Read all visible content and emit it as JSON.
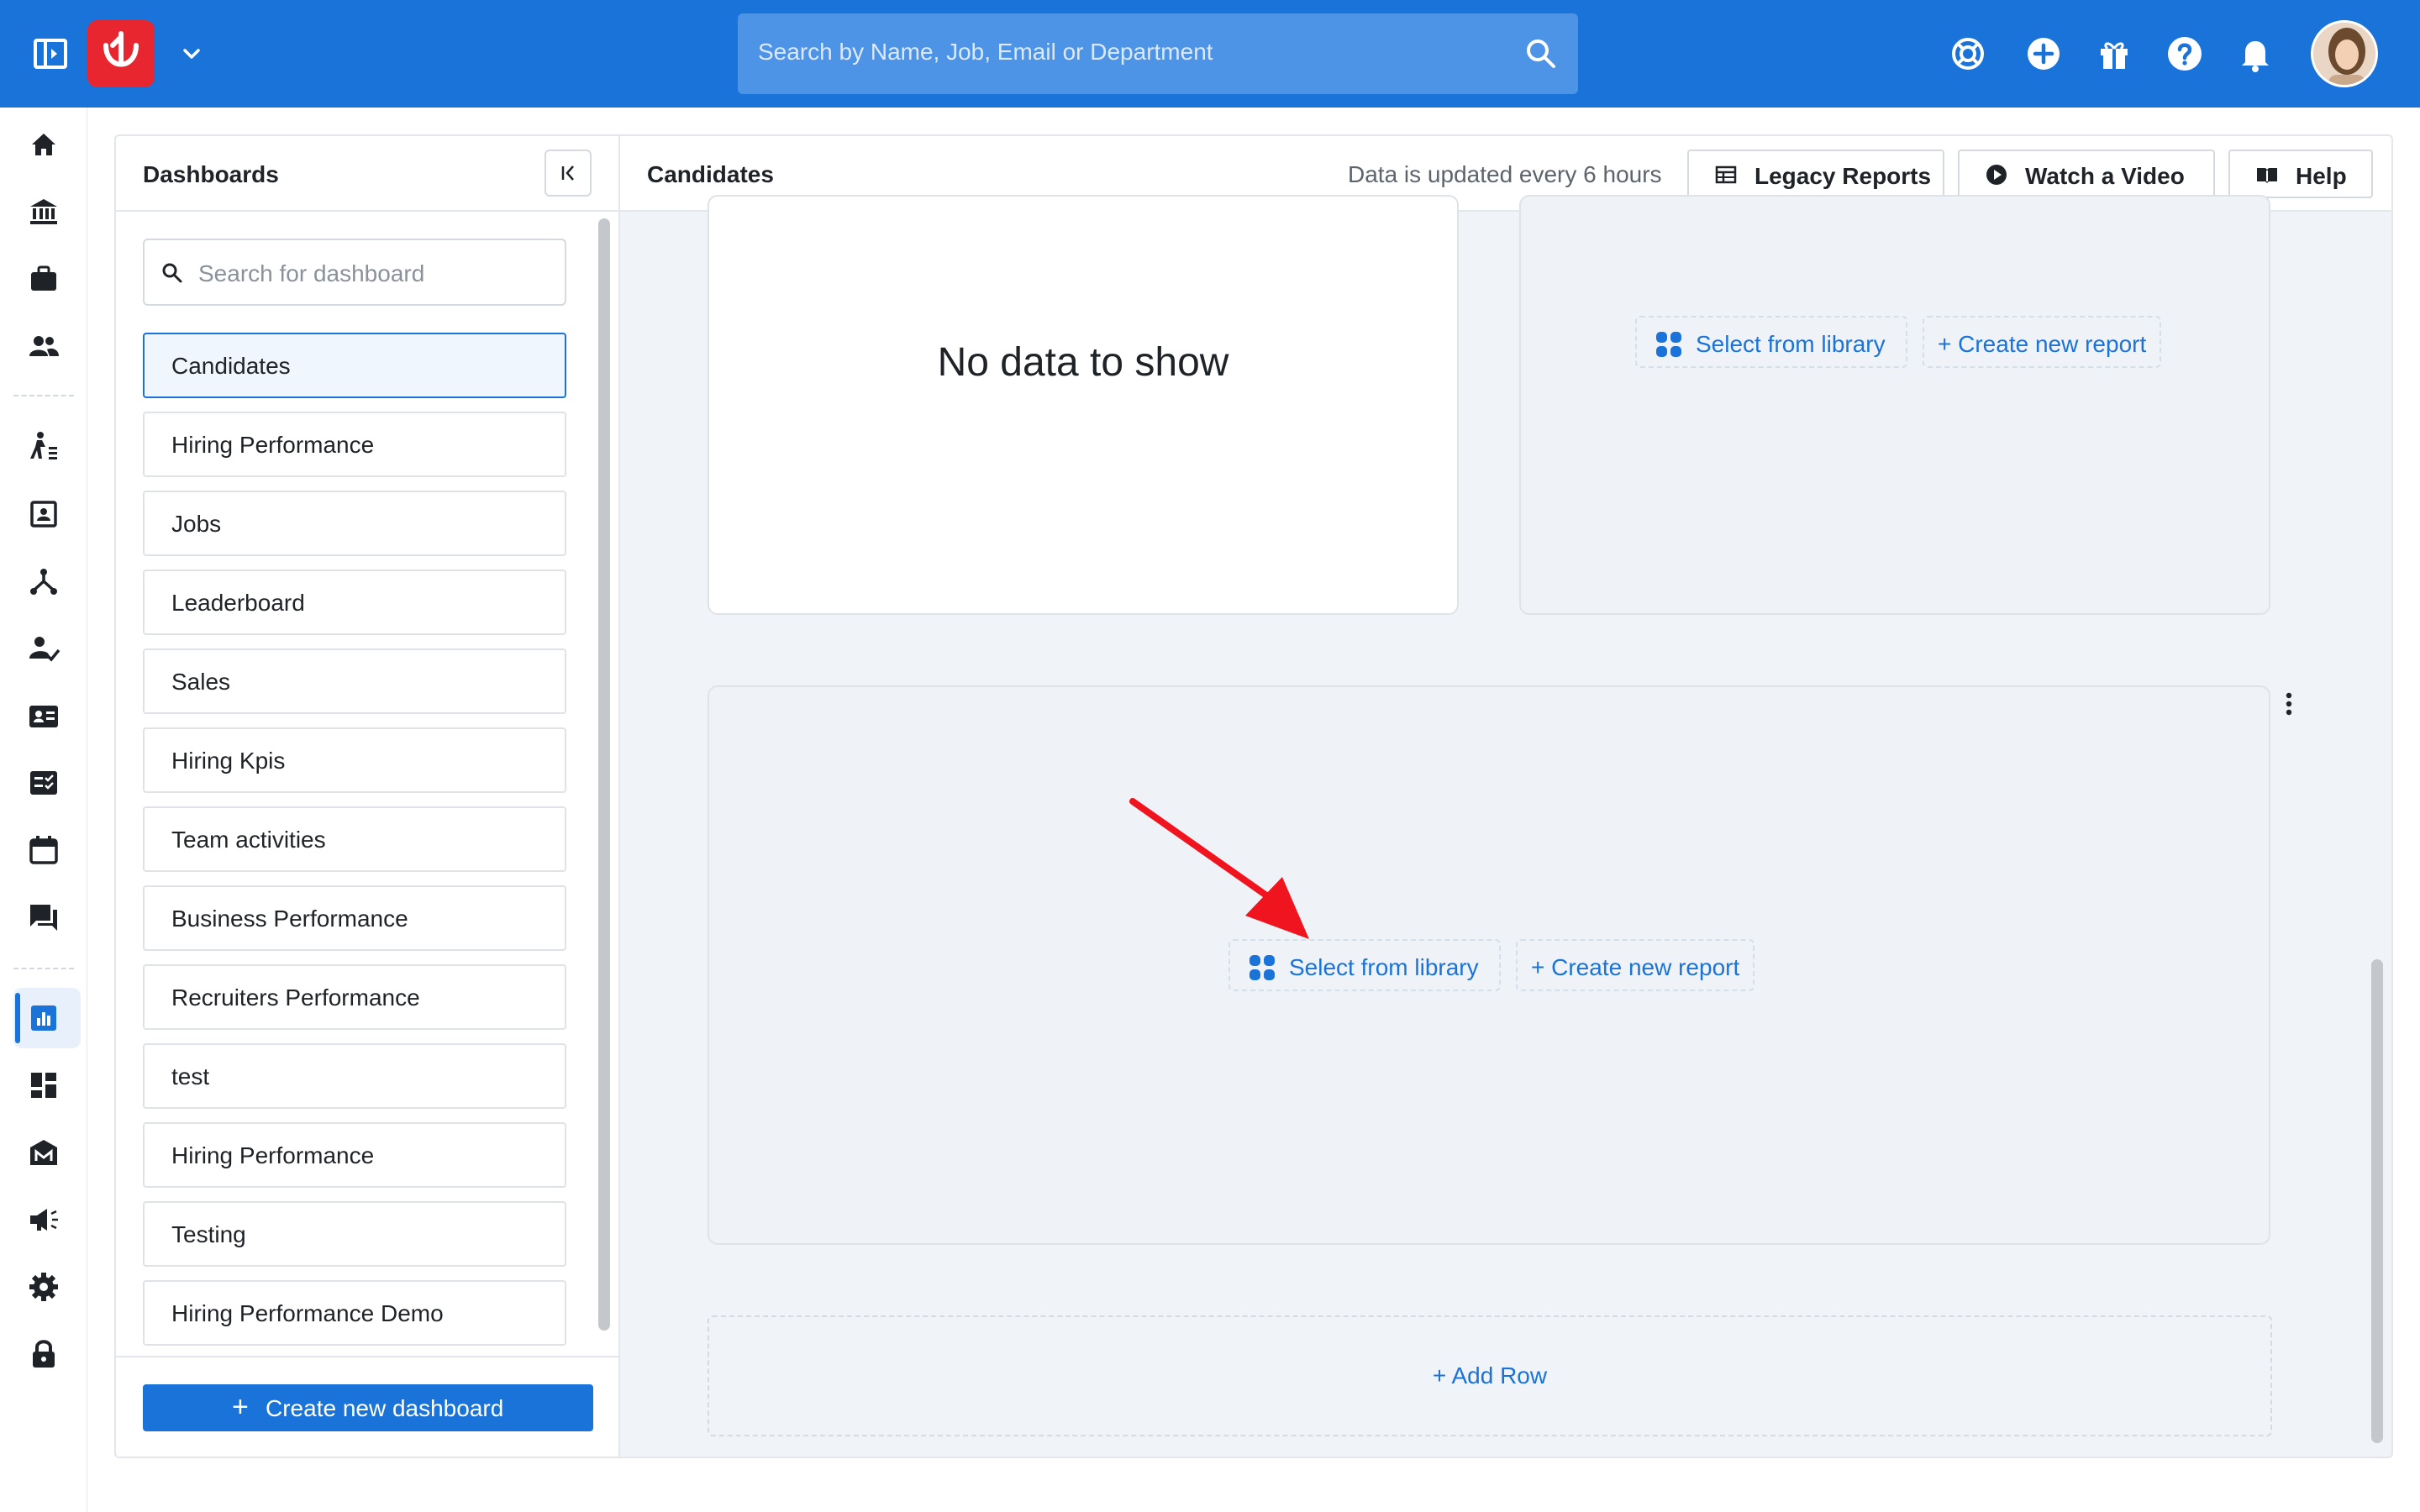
{
  "topbar": {
    "search_placeholder": "Search by Name, Job, Email or Department",
    "icons": [
      "panel-toggle-icon",
      "app-logo",
      "chevron-down-icon",
      "search-icon",
      "support-icon",
      "add-icon",
      "gift-icon",
      "help-icon",
      "bell-icon",
      "avatar"
    ],
    "brand_color": "#1a73d9",
    "logo_color": "#e8262f"
  },
  "rail": {
    "items": [
      "home",
      "bank",
      "briefcase",
      "people",
      "hiring-flow",
      "contact-card",
      "org-chart",
      "user-check",
      "id-card",
      "checklist",
      "calendar",
      "chat",
      "analytics",
      "dashboard",
      "marketplace",
      "announcements",
      "settings",
      "lock"
    ],
    "active": "analytics"
  },
  "dashboards": {
    "title": "Dashboards",
    "search_placeholder": "Search for dashboard",
    "items": [
      {
        "label": "Candidates",
        "active": true
      },
      {
        "label": "Hiring Performance"
      },
      {
        "label": "Jobs"
      },
      {
        "label": "Leaderboard"
      },
      {
        "label": "Sales"
      },
      {
        "label": "Hiring Kpis"
      },
      {
        "label": "Team activities"
      },
      {
        "label": "Business Performance"
      },
      {
        "label": "Recruiters Performance"
      },
      {
        "label": "test"
      },
      {
        "label": "Hiring Performance"
      },
      {
        "label": "Testing"
      },
      {
        "label": "Hiring Performance Demo"
      }
    ],
    "create_plus": "+",
    "create_label": "Create new dashboard"
  },
  "main": {
    "title": "Candidates",
    "update_note": "Data is updated every 6 hours",
    "buttons": {
      "legacy": "Legacy Reports",
      "video": "Watch a Video",
      "help": "Help"
    },
    "cards": {
      "no_data": "No data to show",
      "select_library": "Select from library",
      "create_report": "+ Create new report"
    },
    "add_row": "+ Add Row"
  },
  "colors": {
    "accent": "#1a73d9",
    "annotation_arrow": "#f0141e",
    "canvas": "#f0f4f8"
  }
}
